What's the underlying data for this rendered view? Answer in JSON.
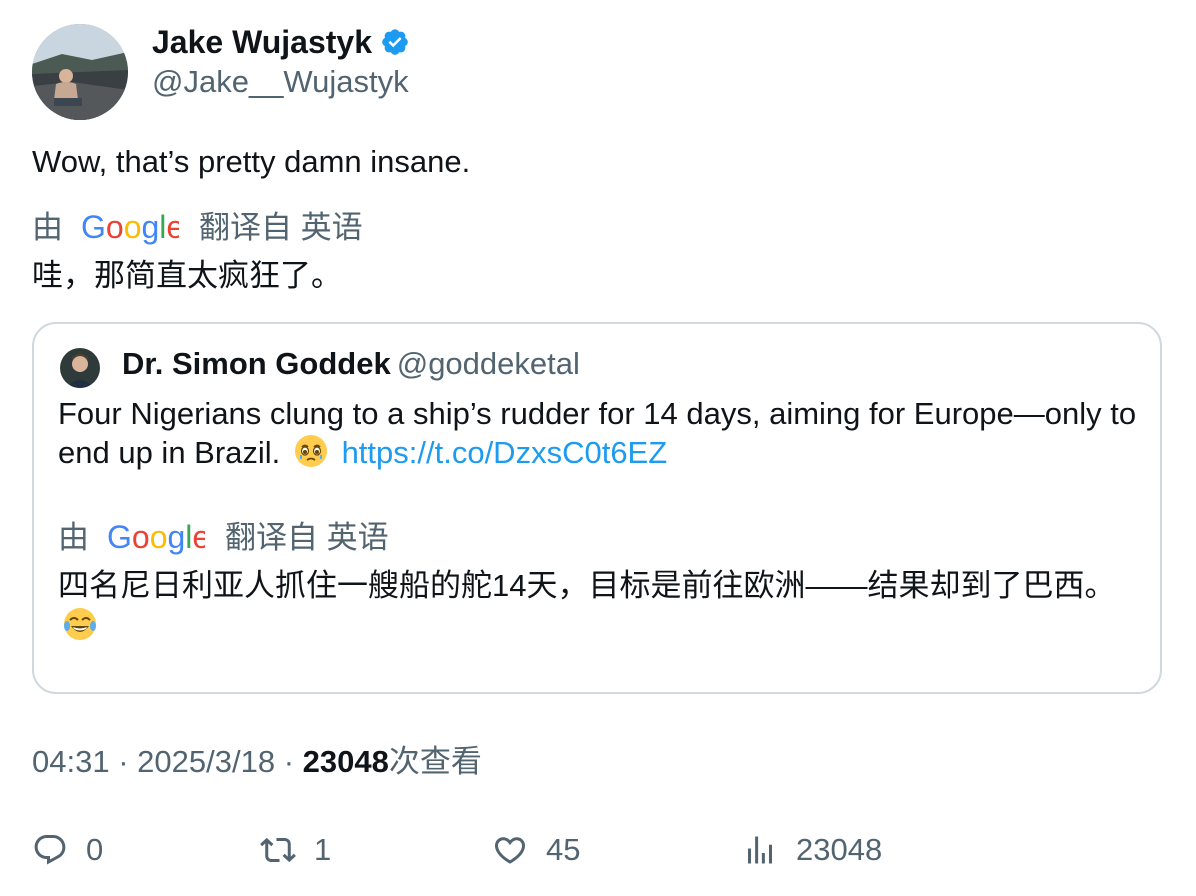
{
  "author": {
    "name": "Jake Wujastyk",
    "handle": "@Jake__Wujastyk",
    "verified": true,
    "verified_color": "#1d9bf0"
  },
  "tweet": {
    "text": "Wow, that’s pretty damn insane.",
    "translation": {
      "by_label": "由",
      "provider": "Google",
      "from_label": "翻译自 英语",
      "text": "哇，那简直太疯狂了。"
    }
  },
  "quote": {
    "name": "Dr. Simon Goddek",
    "handle": "@goddeketal",
    "text_before_emoji": "Four Nigerians clung to a ship’s rudder for 14 days, aiming for Europe—only to end up in Brazil.",
    "link": "https://t.co/DzxsC0t6EZ",
    "translation": {
      "by_label": "由",
      "provider": "Google",
      "from_label": "翻译自 英语",
      "text": "四名尼日利亚人抓住一艘船的舵14天，目标是前往欧洲——结果却到了巴西。"
    }
  },
  "meta": {
    "time": "04:31",
    "separator": "·",
    "date": "2025/3/18",
    "views": "23048",
    "views_suffix": "次查看"
  },
  "actions": {
    "replies": "0",
    "retweets": "1",
    "likes": "45",
    "views": "23048"
  },
  "colors": {
    "text": "#0f1419",
    "secondary": "#536471",
    "link": "#1d9bf0",
    "border": "#cfd9de"
  }
}
